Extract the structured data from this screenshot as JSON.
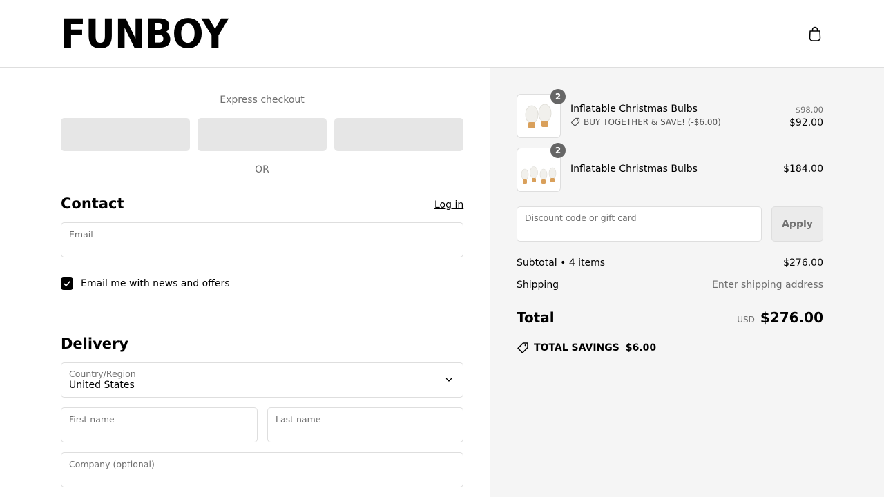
{
  "header": {
    "logo_text": "FUNBOY",
    "cart_icon": "shopping-bag-icon"
  },
  "express": {
    "title": "Express checkout",
    "or_label": "OR"
  },
  "contact": {
    "heading": "Contact",
    "login_label": "Log in",
    "email_label": "Email",
    "email_value": "",
    "newsletter_label": "Email me with news and offers",
    "newsletter_checked": true
  },
  "delivery": {
    "heading": "Delivery",
    "country_label": "Country/Region",
    "country_value": "United States",
    "first_name_label": "First name",
    "last_name_label": "Last name",
    "company_label": "Company (optional)"
  },
  "cart": {
    "items": [
      {
        "name": "Inflatable Christmas Bulbs",
        "quantity": "2",
        "promo": "BUY TOGETHER & SAVE! (-$6.00)",
        "original_price": "$98.00",
        "price": "$92.00"
      },
      {
        "name": "Inflatable Christmas Bulbs",
        "quantity": "2",
        "price": "$184.00"
      }
    ],
    "discount_placeholder": "Discount code or gift card",
    "apply_label": "Apply",
    "subtotal_label": "Subtotal • 4 items",
    "subtotal_value": "$276.00",
    "shipping_label": "Shipping",
    "shipping_value": "Enter shipping address",
    "total_label": "Total",
    "currency": "USD",
    "total_value": "$276.00",
    "savings_label": "TOTAL SAVINGS",
    "savings_value": "$6.00"
  },
  "colors": {
    "accent": "#000000",
    "summary_bg": "#f5f5f5",
    "muted_text": "#707070",
    "border": "#dedede",
    "express_button": "#e6e6e6",
    "bulb_base": "#d9a05b"
  }
}
